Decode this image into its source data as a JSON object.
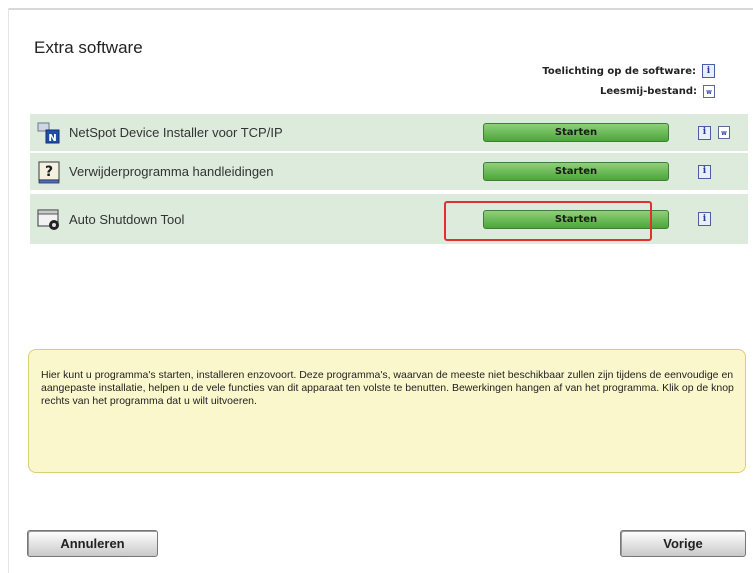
{
  "page": {
    "title": "Extra software"
  },
  "legend": {
    "explanation_label": "Toelichting op de software:",
    "readme_label": "Leesmij-bestand:"
  },
  "programs": [
    {
      "name": "NetSpot Device Installer voor TCP/IP",
      "button": "Starten",
      "has_readme": true
    },
    {
      "name": "Verwijderprogramma handleidingen",
      "button": "Starten",
      "has_readme": false
    },
    {
      "name": "Auto Shutdown Tool",
      "button": "Starten",
      "has_readme": false,
      "highlighted": true
    }
  ],
  "help_text": "Hier kunt u programma's starten, installeren enzovoort. Deze programma's, waarvan de meeste niet beschikbaar zullen zijn tijdens de eenvoudige en aangepaste installatie, helpen u de vele functies van dit apparaat ten volste te benutten. Bewerkingen hangen af van het programma. Klik op de knop rechts van het programma dat u wilt uitvoeren.",
  "buttons": {
    "cancel": "Annuleren",
    "back": "Vorige"
  },
  "icons": {
    "info": "info-icon",
    "readme": "readme-doc-icon",
    "netspot": "netspot-app-icon",
    "uninstall": "help-book-icon",
    "shutdown": "shutdown-window-icon"
  },
  "colors": {
    "row_bg": "#dcebdc",
    "button_green": "#4da53a",
    "highlight": "#e03030",
    "help_bg": "#fbf7cd"
  }
}
